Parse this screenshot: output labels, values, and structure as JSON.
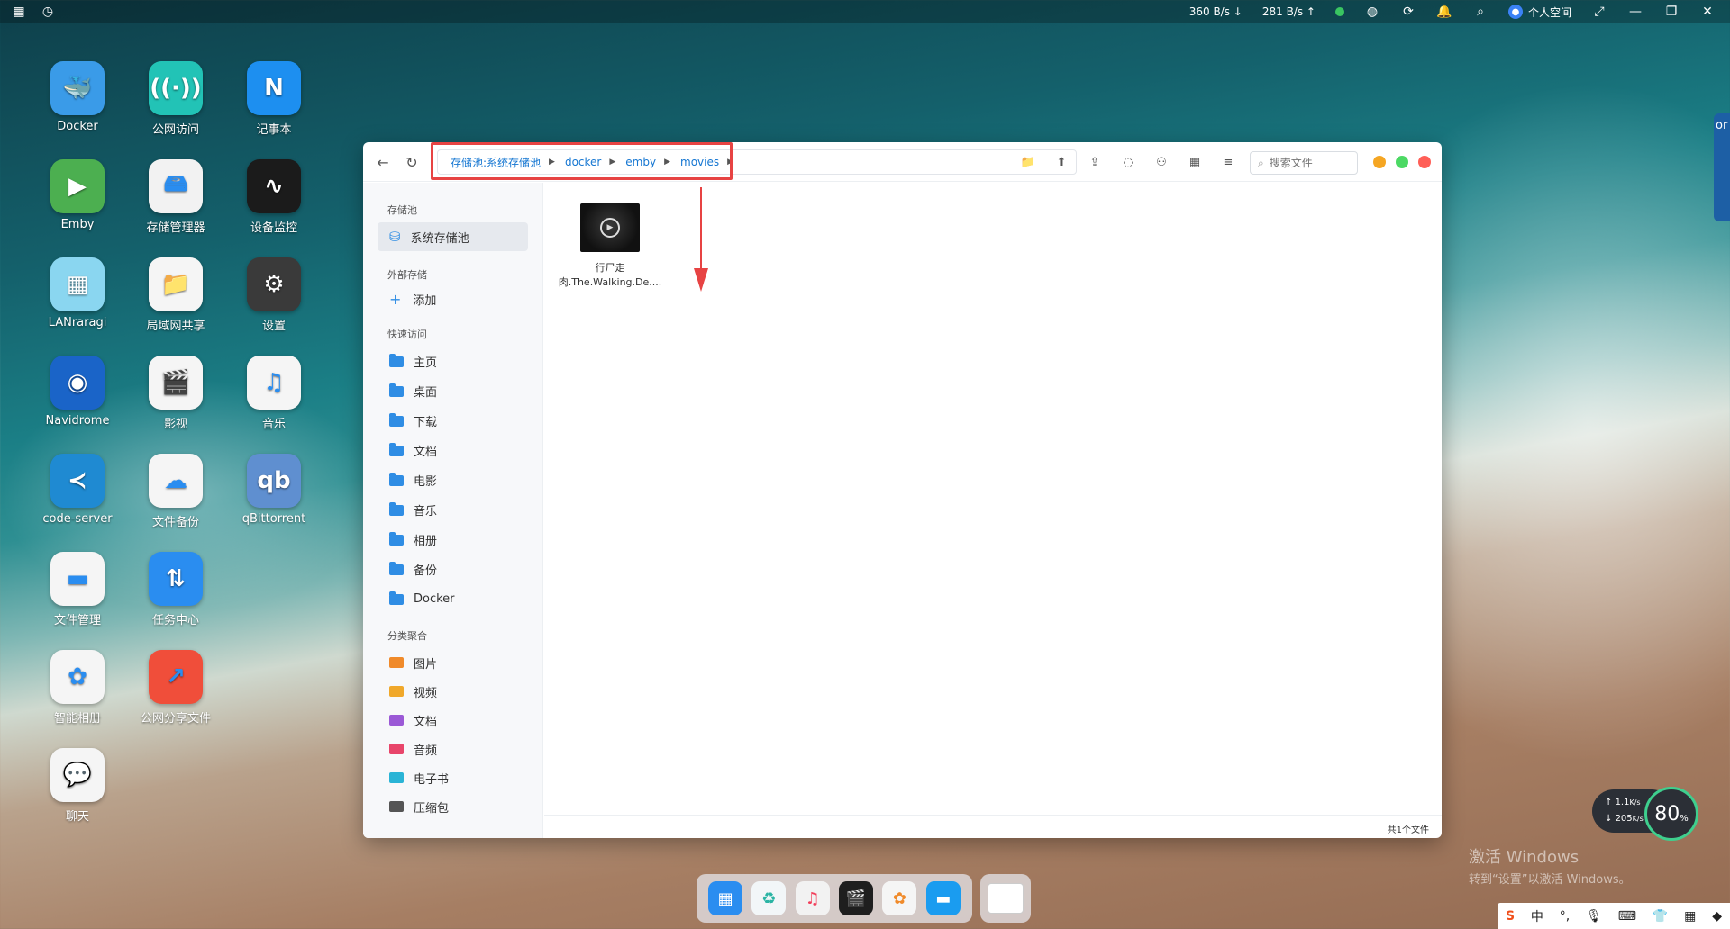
{
  "topbar": {
    "download_speed": "360 B/s",
    "upload_speed": "281 B/s",
    "user_label": "个人空间"
  },
  "desktop": {
    "apps": [
      {
        "label": "Docker",
        "color": "#3a9be8",
        "glyph": "🐳"
      },
      {
        "label": "公网访问",
        "color": "#22c3b6",
        "glyph": "((·))"
      },
      {
        "label": "记事本",
        "color": "#1d8ff0",
        "glyph": "N"
      },
      {
        "label": "Emby",
        "color": "#4caf50",
        "glyph": "▶"
      },
      {
        "label": "存储管理器",
        "color": "#f2f2f2",
        "glyph": "🖴"
      },
      {
        "label": "设备监控",
        "color": "#1b1b1b",
        "glyph": "∿"
      },
      {
        "label": "LANraragi",
        "color": "#8ad6f0",
        "glyph": "▦"
      },
      {
        "label": "局域网共享",
        "color": "#f5f5f5",
        "glyph": "📁"
      },
      {
        "label": "设置",
        "color": "#3a3a3a",
        "glyph": "⚙"
      },
      {
        "label": "Navidrome",
        "color": "#1a64c8",
        "glyph": "◉"
      },
      {
        "label": "影视",
        "color": "#f5f5f5",
        "glyph": "🎬"
      },
      {
        "label": "音乐",
        "color": "#f5f5f5",
        "glyph": "♫"
      },
      {
        "label": "code-server",
        "color": "#1f8ad2",
        "glyph": "≺"
      },
      {
        "label": "文件备份",
        "color": "#f5f5f5",
        "glyph": "☁"
      },
      {
        "label": "qBittorrent",
        "color": "#5f8fd0",
        "glyph": "qb"
      },
      {
        "label": "文件管理",
        "color": "#f5f5f5",
        "glyph": "▬"
      },
      {
        "label": "任务中心",
        "color": "#2a8df0",
        "glyph": "⇅"
      },
      {
        "label": "智能相册",
        "color": "#f5f5f5",
        "glyph": "✿"
      },
      {
        "label": "公网分享文件",
        "color": "#f04e3a",
        "glyph": "↗"
      },
      {
        "label": "聊天",
        "color": "#f5f5f5",
        "glyph": "💬"
      }
    ]
  },
  "window": {
    "breadcrumbs": [
      "存储池:系统存储池",
      "docker",
      "emby",
      "movies"
    ],
    "search_placeholder": "搜索文件",
    "sidebar": {
      "storage_title": "存储池",
      "storage_item": "系统存储池",
      "external_title": "外部存储",
      "external_add": "添加",
      "quick_title": "快速访问",
      "quick_items": [
        "主页",
        "桌面",
        "下载",
        "文档",
        "电影",
        "音乐",
        "相册",
        "备份",
        "Docker"
      ],
      "category_title": "分类聚合",
      "category_items": [
        "图片",
        "视频",
        "文档",
        "音频",
        "电子书",
        "压缩包"
      ]
    },
    "file": {
      "name_line1": "行尸走",
      "name_line2": "肉.The.Walking.De...."
    },
    "status": "共1个文件"
  },
  "widgets": {
    "speed_up": "1.1",
    "speed_up_unit": "K/s",
    "speed_down": "205",
    "speed_down_unit": "K/s",
    "gauge_value": "80",
    "gauge_unit": "%"
  },
  "watermark": {
    "line1": "激活 Windows",
    "line2": "转到“设置”以激活 Windows。"
  },
  "ime": {
    "lang": "中"
  },
  "edge_widget": {
    "text": "or"
  },
  "colors": {
    "accent": "#1677d2",
    "highlight_red": "#e74343",
    "light_orange": "#f5a623",
    "light_green": "#4cd964",
    "light_red": "#ff5f57"
  }
}
